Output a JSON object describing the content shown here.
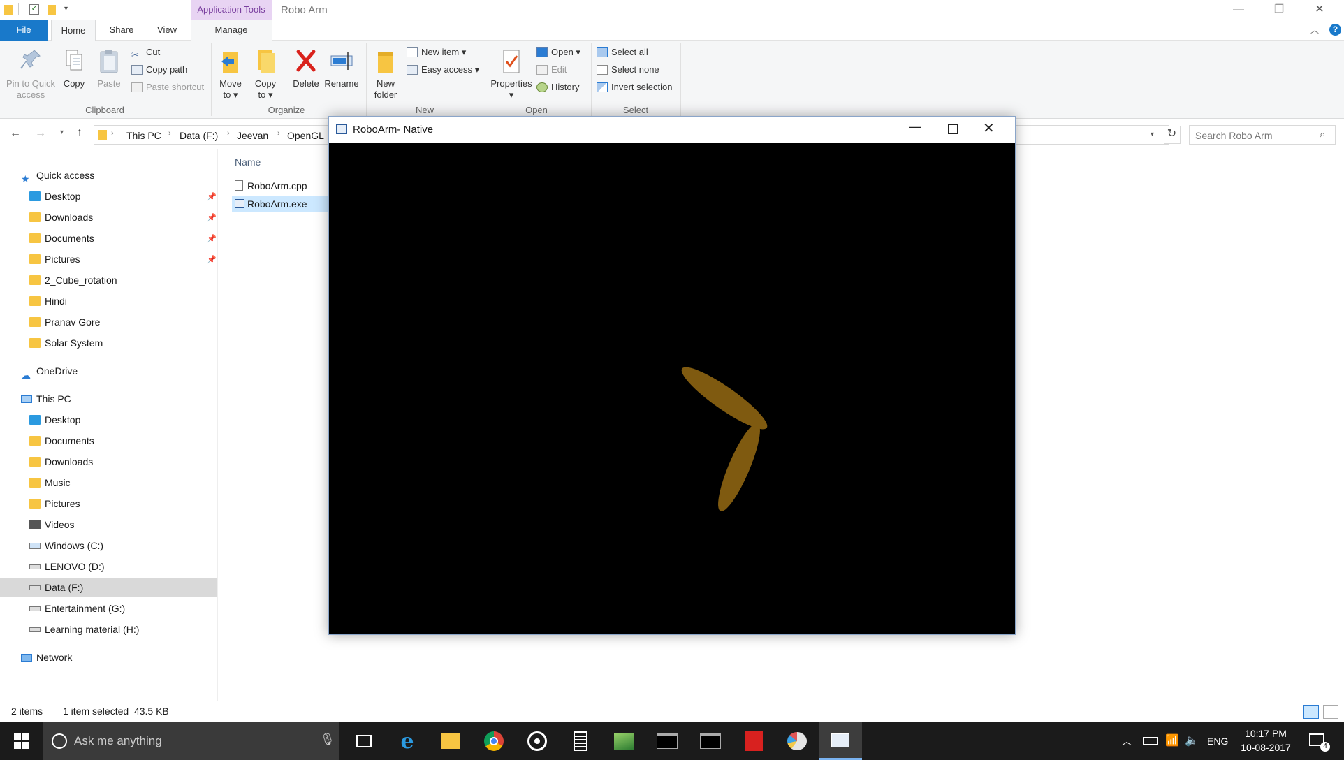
{
  "titlebar": {
    "app_tools": "Application Tools",
    "title": "Robo Arm",
    "minimize": "—",
    "restore": "❐",
    "close": "✕"
  },
  "tabs": {
    "file": "File",
    "home": "Home",
    "share": "Share",
    "view": "View",
    "manage": "Manage"
  },
  "ribbon": {
    "clipboard": {
      "pin": "Pin to Quick access",
      "copy": "Copy",
      "paste": "Paste",
      "cut": "Cut",
      "copy_path": "Copy path",
      "paste_shortcut": "Paste shortcut",
      "label": "Clipboard"
    },
    "organize": {
      "move_to": "Move to",
      "copy_to": "Copy to",
      "delete": "Delete",
      "rename": "Rename",
      "label": "Organize"
    },
    "new": {
      "new_folder": "New folder",
      "new_item": "New item",
      "easy_access": "Easy access",
      "label": "New"
    },
    "open": {
      "properties": "Properties",
      "open": "Open",
      "edit": "Edit",
      "history": "History",
      "label": "Open"
    },
    "select": {
      "select_all": "Select all",
      "select_none": "Select none",
      "invert": "Invert selection",
      "label": "Select"
    }
  },
  "address": {
    "crumbs": [
      "This PC",
      "Data (F:)",
      "Jeevan",
      "OpenGL"
    ],
    "search_placeholder": "Search Robo Arm"
  },
  "nav": {
    "quick_access": "Quick access",
    "quick_items": [
      "Desktop",
      "Downloads",
      "Documents",
      "Pictures",
      "2_Cube_rotation",
      "Hindi",
      "Pranav Gore",
      "Solar System"
    ],
    "onedrive": "OneDrive",
    "this_pc": "This PC",
    "pc_items": [
      "Desktop",
      "Documents",
      "Downloads",
      "Music",
      "Pictures",
      "Videos",
      "Windows (C:)",
      "LENOVO (D:)",
      "Data (F:)",
      "Entertainment (G:)",
      "Learning material (H:)"
    ],
    "network": "Network"
  },
  "content": {
    "column_name": "Name",
    "files": [
      "RoboArm.cpp",
      "RoboArm.exe"
    ]
  },
  "status": {
    "items": "2 items",
    "selected": "1 item selected  43.5 KB"
  },
  "robo_window": {
    "title": "RoboArm- Native",
    "arm_color": "#7f5a10"
  },
  "taskbar": {
    "search_placeholder": "Ask me anything",
    "lang": "ENG",
    "time": "10:17 PM",
    "date": "10-08-2017",
    "notif_count": "4"
  }
}
